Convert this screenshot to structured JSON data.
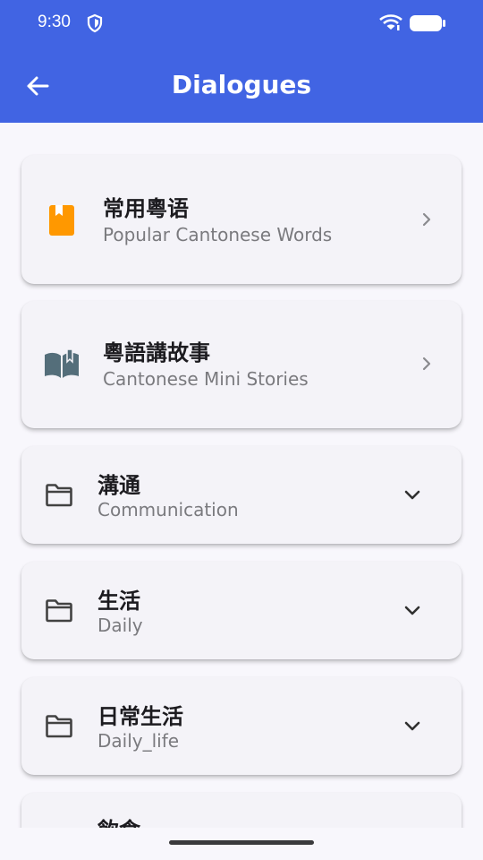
{
  "status_bar": {
    "time": "9:30",
    "icons": [
      "shield-icon",
      "wifi-icon",
      "battery-icon"
    ]
  },
  "app_bar": {
    "title": "Dialogues",
    "back_icon": "arrow-back-icon",
    "background": "#4164e3"
  },
  "items": [
    {
      "title": "常用粵语",
      "subtitle": "Popular Cantonese Words",
      "icon": "book-icon",
      "icon_color": "#ff9800",
      "trailing": "chevron-right-icon"
    },
    {
      "title": "粵語講故事",
      "subtitle": "Cantonese Mini Stories",
      "icon": "open-book-icon",
      "icon_color": "#546e7a",
      "trailing": "chevron-right-icon"
    },
    {
      "title": "溝通",
      "subtitle": "Communication",
      "icon": "folder-icon",
      "trailing": "expand-more-icon"
    },
    {
      "title": "生活",
      "subtitle": "Daily",
      "icon": "folder-icon",
      "trailing": "expand-more-icon"
    },
    {
      "title": "日常生活",
      "subtitle": "Daily_life",
      "icon": "folder-icon",
      "trailing": "expand-more-icon"
    },
    {
      "title": "飲食",
      "subtitle": "",
      "icon": "folder-icon",
      "trailing": "expand-more-icon"
    }
  ]
}
